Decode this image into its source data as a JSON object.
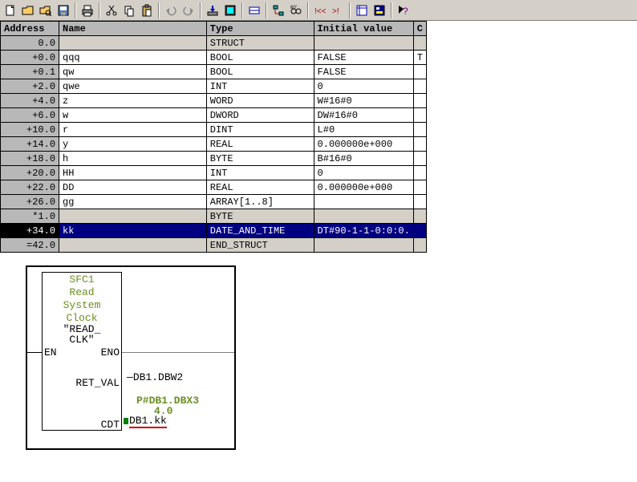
{
  "toolbar": {
    "icons": [
      "new-icon",
      "open-icon",
      "save-magnify-icon",
      "save-icon",
      "sep",
      "print-icon",
      "sep",
      "cut-icon",
      "copy-icon",
      "paste-icon",
      "sep",
      "undo-icon",
      "redo-icon",
      "sep",
      "download-icon",
      "download2-icon",
      "sep",
      "module-icon",
      "sep",
      "network-icon",
      "glasses-icon",
      "sep",
      "goto-start-icon",
      "goto-marker-icon",
      "sep",
      "lad-icon",
      "overview-icon",
      "sep",
      "help-icon"
    ]
  },
  "columns": {
    "address": "Address",
    "name": "Name",
    "type": "Type",
    "initial": "Initial value",
    "comment": "C"
  },
  "rows": [
    {
      "addr": "0.0",
      "name": "",
      "type": "STRUCT",
      "init": "",
      "gray": true
    },
    {
      "addr": "+0.0",
      "name": "qqq",
      "type": "BOOL",
      "init": "FALSE",
      "commcut": "T"
    },
    {
      "addr": "+0.1",
      "name": "qw",
      "type": "BOOL",
      "init": "FALSE"
    },
    {
      "addr": "+2.0",
      "name": "qwe",
      "type": "INT",
      "init": "0"
    },
    {
      "addr": "+4.0",
      "name": "z",
      "type": "WORD",
      "init": "W#16#0"
    },
    {
      "addr": "+6.0",
      "name": "w",
      "type": "DWORD",
      "init": "DW#16#0"
    },
    {
      "addr": "+10.0",
      "name": "r",
      "type": "DINT",
      "init": "L#0"
    },
    {
      "addr": "+14.0",
      "name": "y",
      "type": "REAL",
      "init": "0.000000e+000"
    },
    {
      "addr": "+18.0",
      "name": "h",
      "type": "BYTE",
      "init": "B#16#0"
    },
    {
      "addr": "+20.0",
      "name": "HH",
      "type": "INT",
      "init": "0"
    },
    {
      "addr": "+22.0",
      "name": "DD",
      "type": "REAL",
      "init": "0.000000e+000"
    },
    {
      "addr": "+26.0",
      "name": "gg",
      "type": "ARRAY[1..8]",
      "init": ""
    },
    {
      "addr": "*1.0",
      "name": "",
      "type": "BYTE",
      "init": "",
      "gray": true
    },
    {
      "addr": "+34.0",
      "name": "kk",
      "type": "DATE_AND_TIME",
      "init": "DT#90-1-1-0:0:0.",
      "sel": true
    },
    {
      "addr": "=42.0",
      "name": "",
      "type": "END_STRUCT",
      "init": "",
      "gray": true
    }
  ],
  "fbd": {
    "block_id": "SFC1",
    "block_desc1": "Read",
    "block_desc2": "System",
    "block_desc3": "Clock",
    "quoted1": "\"READ_",
    "quoted2": "CLK\"",
    "port_en": "EN",
    "port_eno": "ENO",
    "port_retval": "RET_VAL",
    "port_cdt": "CDT",
    "out_retval": "DB1.DBW2",
    "annot1": "P#DB1.DBX3",
    "annot2": "4.0",
    "out_cdt": "DB1.kk"
  }
}
